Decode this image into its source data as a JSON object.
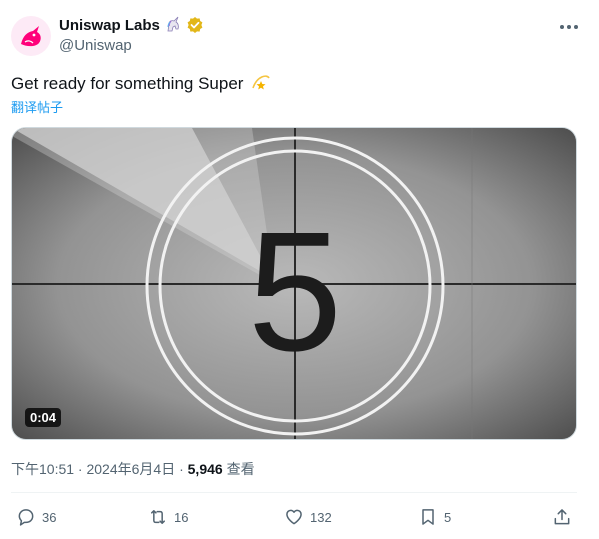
{
  "tweet": {
    "author_name": "Uniswap Labs",
    "handle": "@Uniswap",
    "text": "Get ready for something Super",
    "translate_label": "翻译帖子",
    "video_duration": "0:04",
    "countdown_number": "5",
    "timestamp": "下午10:51 · 2024年6月4日 · ",
    "views_count": "5,946",
    "views_label": "查看",
    "icons": {
      "name_emoji": "unicorn-icon",
      "verified": "verified-badge-icon",
      "text_emoji": "dizzy-star-icon"
    }
  },
  "actions": {
    "replies": "36",
    "reposts": "16",
    "likes": "132",
    "bookmarks": "5"
  },
  "colors": {
    "link": "#1d9bf0",
    "secondary_text": "#536471",
    "verified": "#e2b719",
    "brand_pink": "#ff007a"
  }
}
